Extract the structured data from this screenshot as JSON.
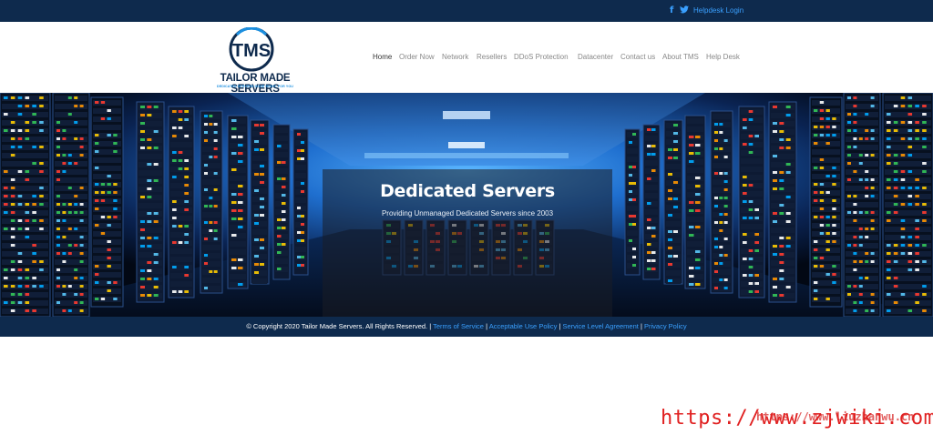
{
  "topbar": {
    "facebook_icon": "f",
    "twitter_icon": "twitter-bird",
    "helpdesk_label": "Helpdesk Login"
  },
  "logo": {
    "mark": "TMS",
    "name": "TAILOR MADE SERVERS",
    "tagline": "DEDICATED SERVERS DONE RIGHT, FOR YOU"
  },
  "nav": {
    "items": [
      {
        "label": "Home"
      },
      {
        "label": "Order Now"
      },
      {
        "label": "Network"
      },
      {
        "label": "Resellers"
      },
      {
        "label": "DDoS Protection"
      },
      {
        "label": "Datacenter"
      },
      {
        "label": "Contact us"
      },
      {
        "label": "About TMS"
      },
      {
        "label": "Help Desk"
      }
    ]
  },
  "hero": {
    "title": "Dedicated Servers",
    "subtitle": "Providing Unmanaged Dedicated Servers since 2003"
  },
  "footer": {
    "copyright": "© Copyright 2020 Tailor Made Servers. All Rights Reserved. |",
    "links": [
      "Terms of Service",
      "Acceptable Use Policy",
      "Service Level Agreement",
      "Privacy Policy"
    ],
    "separator": "|"
  },
  "watermark": {
    "faint": "https://www.liuzhanwu.cn",
    "main": "https://www.zjwiki.com"
  },
  "colors": {
    "navy": "#0e2a4d",
    "link_blue": "#3aa0ff",
    "brand_blue": "#1b8fe0"
  }
}
